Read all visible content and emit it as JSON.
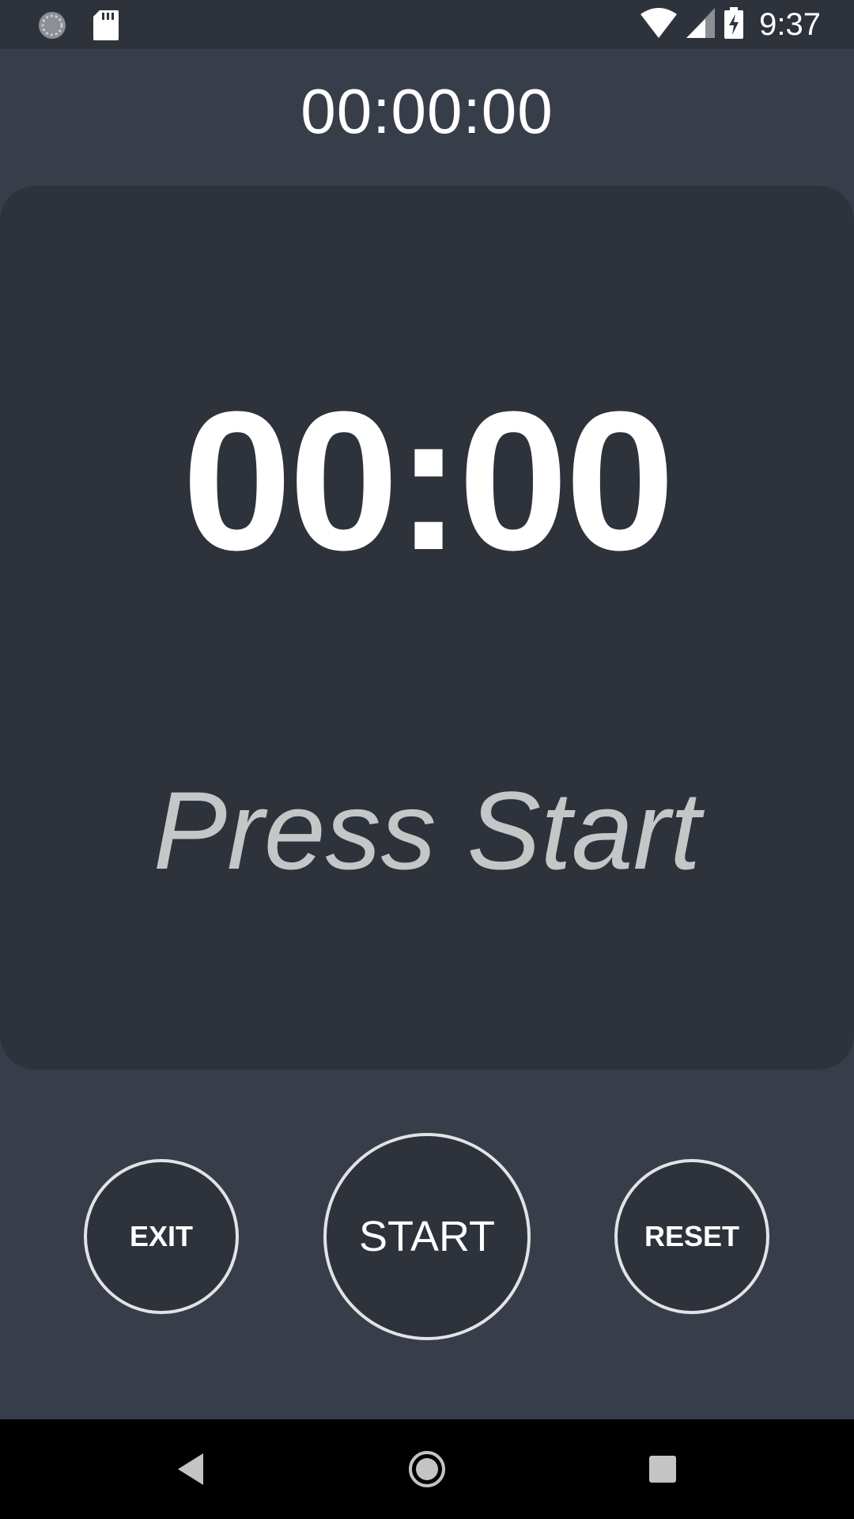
{
  "status_bar": {
    "time": "9:37",
    "icons": [
      "sync-icon",
      "sd-card-icon",
      "wifi-icon",
      "cell-signal-icon",
      "battery-charging-icon"
    ]
  },
  "timer": {
    "total_elapsed": "00:00:00",
    "current": "00:00",
    "prompt": "Press Start"
  },
  "controls": {
    "exit_label": "EXIT",
    "start_label": "START",
    "reset_label": "RESET"
  },
  "nav": {
    "icons": [
      "back-icon",
      "home-icon",
      "recents-icon"
    ]
  },
  "colors": {
    "background": "#383e49",
    "card": "#2e323b",
    "text": "#ffffff",
    "prompt_text": "#c5c6c8",
    "button_border": "#e3e3e6"
  }
}
